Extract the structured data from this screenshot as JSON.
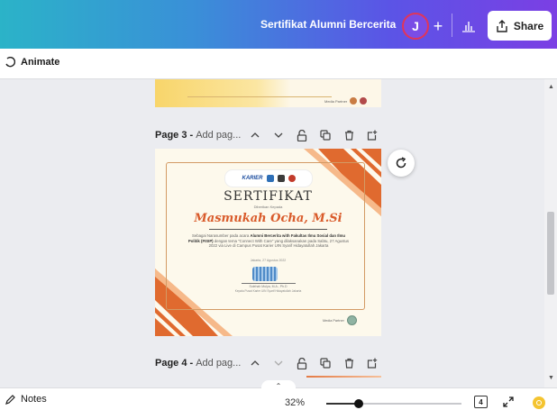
{
  "header": {
    "doc_title": "Sertifikat Alumni Bercerita",
    "avatar_initial": "J",
    "share_label": "Share",
    "colors": {
      "gradient_start": "#2bb3c8",
      "gradient_end": "#7b3fe4",
      "avatar_ring": "#e0355a"
    }
  },
  "toolbar": {
    "animate_label": "Animate"
  },
  "pages": [
    {
      "label": "Page 3 -",
      "title_placeholder": "Add pag..."
    },
    {
      "label": "Page 4 -",
      "title_placeholder": "Add pag..."
    }
  ],
  "certificate": {
    "logo_text": "KARIER",
    "title": "SERTIFIKAT",
    "subtitle": "Diberikan Kepada",
    "recipient": "Masmukah Ocha, M.Si",
    "body_line1": "Sebagai Narasumber pada acara",
    "body_bold1": "Alumni Bercerita with Fakultas",
    "body_bold2": "Ilmu Sosial dan Ilmu Politik (FISIP)",
    "body_line2": "dengan tema \"Connect With Care\" yang dilaksanakan pada Sabtu, 27 Agustus 2022 via Live di Campus Pusat Karier UIN Syarif Hidayatullah Jakarta",
    "date_line": "Jakarta, 27 Agustus 2022",
    "signer_name": "Solehah Mulya, M.A., Ph.D",
    "signer_role": "Kepala Pusat Karier UIN Syarif Hidayatullah Jakarta",
    "footer_text": "Media Partner",
    "accent": "#d95b2b"
  },
  "previous_page": {
    "footer_text": "Media Partner"
  },
  "bottombar": {
    "notes_label": "Notes",
    "zoom_value": "32%",
    "zoom_fraction": 0.24,
    "page_count": "4"
  }
}
